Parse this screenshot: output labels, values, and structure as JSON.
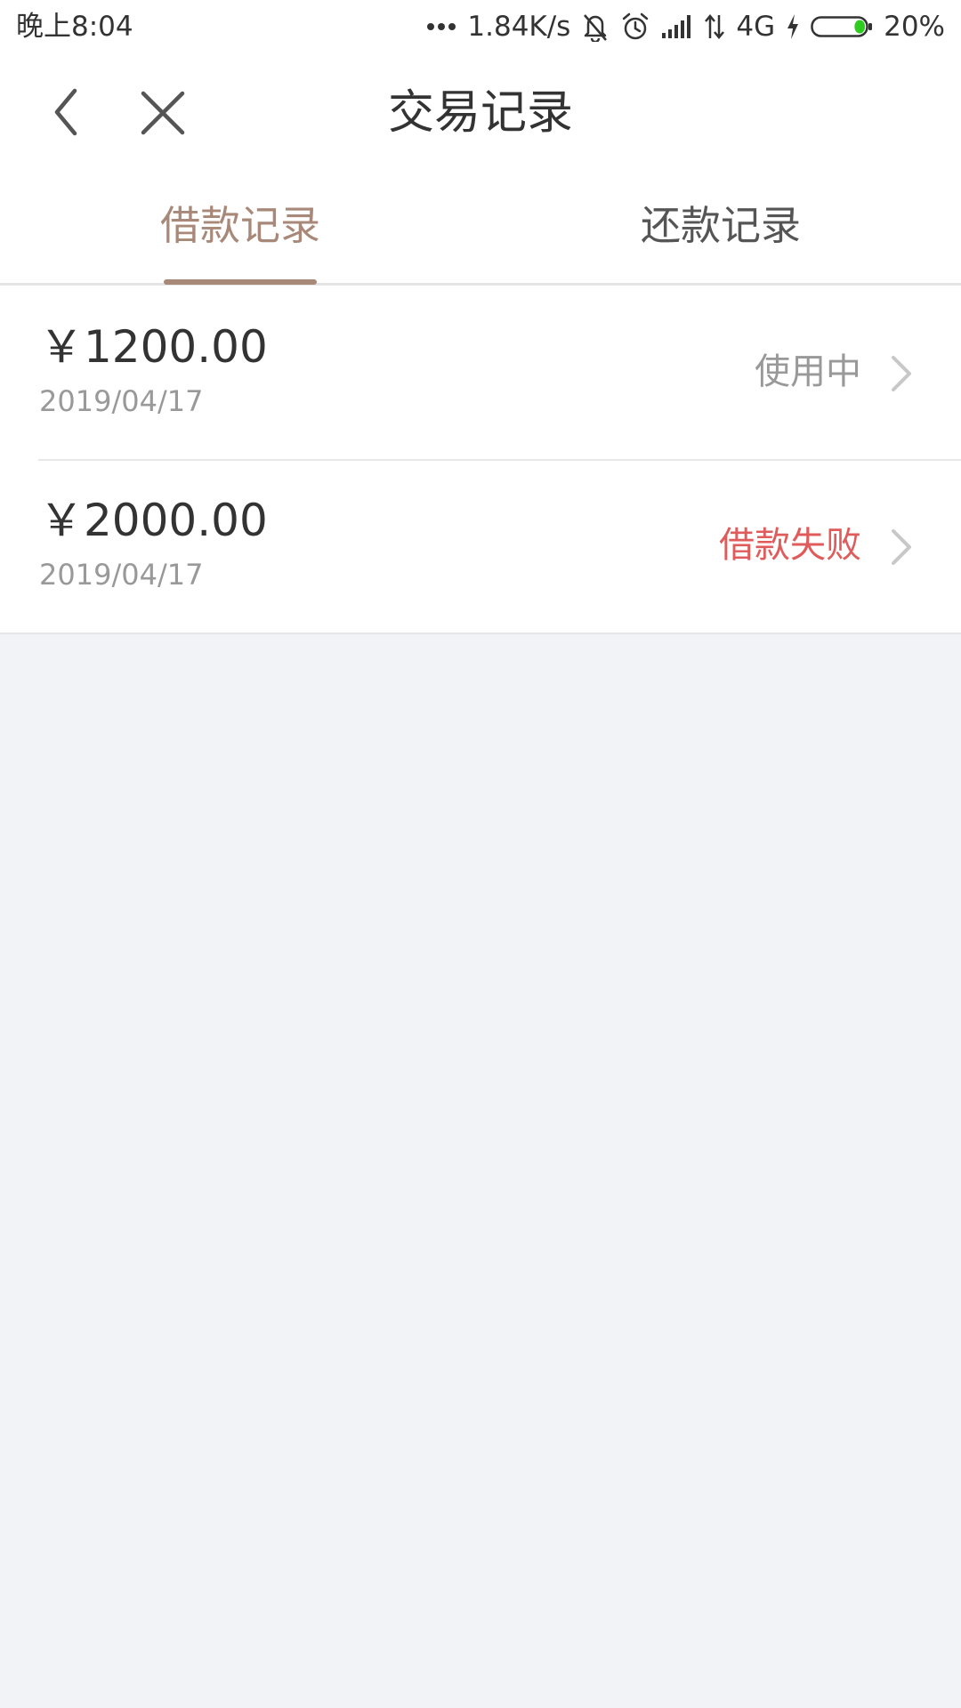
{
  "status_bar": {
    "time": "晚上8:04",
    "network_speed": "1.84K/s",
    "network_type": "4G",
    "battery_percent": "20%",
    "battery_level": 0.2,
    "battery_color": "#2ecc1f"
  },
  "header": {
    "title": "交易记录"
  },
  "tabs": [
    {
      "label": "借款记录",
      "active": true
    },
    {
      "label": "还款记录",
      "active": false
    }
  ],
  "colors": {
    "accent": "#a88878",
    "failed": "#e05b5b",
    "muted": "#999999",
    "background": "#f2f3f7"
  },
  "records": [
    {
      "amount": "￥1200.00",
      "date": "2019/04/17",
      "status": "使用中"
    },
    {
      "amount": "￥2000.00",
      "date": "2019/04/17",
      "status": "借款失败"
    }
  ]
}
